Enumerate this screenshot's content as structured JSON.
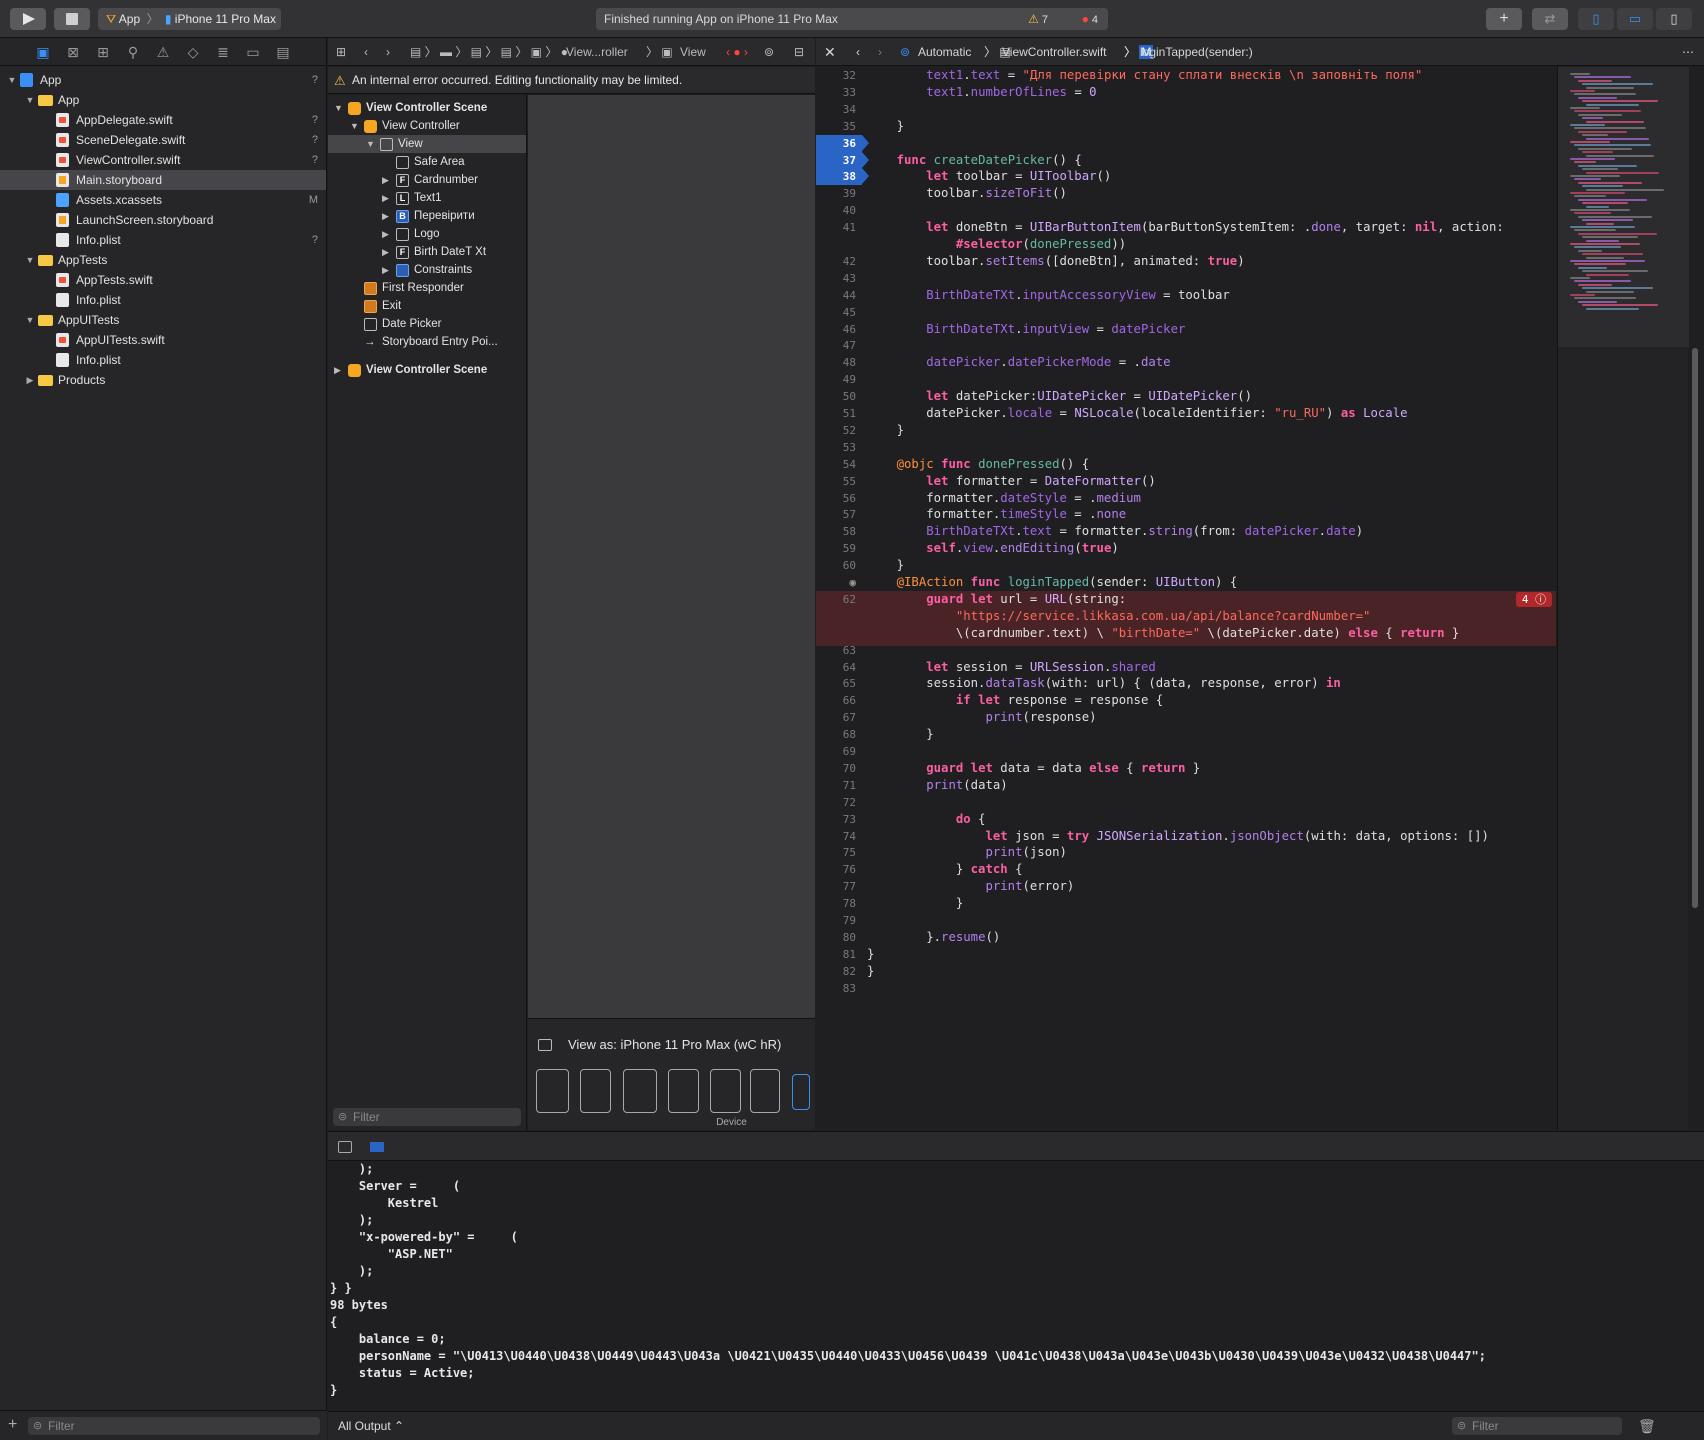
{
  "toolbar": {
    "scheme_app": "App",
    "scheme_device": "iPhone 11 Pro Max",
    "status_text": "Finished running App on iPhone 11 Pro Max",
    "warning_count": "7",
    "error_count": "4",
    "add_icon": "plus-icon"
  },
  "navigator": {
    "items": [
      {
        "label": "App",
        "badge": "?",
        "level": 0,
        "type": "proj",
        "disc": "▼"
      },
      {
        "label": "App",
        "badge": "",
        "level": 1,
        "type": "folder",
        "disc": "▼"
      },
      {
        "label": "AppDelegate.swift",
        "badge": "?",
        "level": 2,
        "type": "swift",
        "disc": ""
      },
      {
        "label": "SceneDelegate.swift",
        "badge": "?",
        "level": 2,
        "type": "swift",
        "disc": ""
      },
      {
        "label": "ViewController.swift",
        "badge": "?",
        "level": 2,
        "type": "swift",
        "disc": ""
      },
      {
        "label": "Main.storyboard",
        "badge": "",
        "level": 2,
        "type": "sb",
        "disc": "",
        "selected": true
      },
      {
        "label": "Assets.xcassets",
        "badge": "M",
        "level": 2,
        "type": "assets",
        "disc": ""
      },
      {
        "label": "LaunchScreen.storyboard",
        "badge": "",
        "level": 2,
        "type": "sb",
        "disc": ""
      },
      {
        "label": "Info.plist",
        "badge": "?",
        "level": 2,
        "type": "plist",
        "disc": ""
      },
      {
        "label": "AppTests",
        "badge": "",
        "level": 1,
        "type": "folder",
        "disc": "▼"
      },
      {
        "label": "AppTests.swift",
        "badge": "",
        "level": 2,
        "type": "swift",
        "disc": ""
      },
      {
        "label": "Info.plist",
        "badge": "",
        "level": 2,
        "type": "plist",
        "disc": ""
      },
      {
        "label": "AppUITests",
        "badge": "",
        "level": 1,
        "type": "folder",
        "disc": "▼"
      },
      {
        "label": "AppUITests.swift",
        "badge": "",
        "level": 2,
        "type": "swift",
        "disc": ""
      },
      {
        "label": "Info.plist",
        "badge": "",
        "level": 2,
        "type": "plist",
        "disc": ""
      },
      {
        "label": "Products",
        "badge": "",
        "level": 1,
        "type": "folder",
        "disc": "▶"
      }
    ],
    "filter_placeholder": "Filter"
  },
  "ib": {
    "jump_view_controller": "View...roller",
    "jump_view": "View",
    "warning_banner": "An internal error occurred. Editing functionality may be limited.",
    "outline": [
      {
        "label": "View Controller Scene",
        "level": 0,
        "disc": "▼",
        "icon": "yellow",
        "glyph": "",
        "bold": true
      },
      {
        "label": "View Controller",
        "level": 1,
        "disc": "▼",
        "icon": "yellow",
        "glyph": ""
      },
      {
        "label": "View",
        "level": 2,
        "disc": "▼",
        "icon": "plain",
        "glyph": "",
        "selected": true
      },
      {
        "label": "Safe Area",
        "level": 3,
        "disc": "",
        "icon": "plain",
        "glyph": ""
      },
      {
        "label": "Cardnumber",
        "level": 3,
        "disc": "▶",
        "icon": "plain",
        "glyph": "F"
      },
      {
        "label": "Text1",
        "level": 3,
        "disc": "▶",
        "icon": "plain",
        "glyph": "L"
      },
      {
        "label": "Перевірити",
        "level": 3,
        "disc": "▶",
        "icon": "blue",
        "glyph": "B"
      },
      {
        "label": "Logo",
        "level": 3,
        "disc": "▶",
        "icon": "plain",
        "glyph": ""
      },
      {
        "label": "Birth DateT Xt",
        "level": 3,
        "disc": "▶",
        "icon": "plain",
        "glyph": "F"
      },
      {
        "label": "Constraints",
        "level": 3,
        "disc": "▶",
        "icon": "blue",
        "glyph": ""
      },
      {
        "label": "First Responder",
        "level": 1,
        "disc": "",
        "icon": "orange",
        "glyph": ""
      },
      {
        "label": "Exit",
        "level": 1,
        "disc": "",
        "icon": "orange",
        "glyph": ""
      },
      {
        "label": "Date Picker",
        "level": 1,
        "disc": "",
        "icon": "plain",
        "glyph": ""
      },
      {
        "label": "Storyboard Entry Poi...",
        "level": 1,
        "disc": "",
        "icon": "arrow",
        "glyph": "→"
      },
      {
        "label": "View Controller Scene",
        "level": 0,
        "disc": "▶",
        "icon": "yellow",
        "glyph": "",
        "bold": true,
        "gap": true
      }
    ],
    "filter_placeholder": "Filter",
    "view_as": "View as: iPhone 11 Pro Max (wC hR)",
    "device_label": "Device"
  },
  "editor": {
    "jump_automatic": "Automatic",
    "jump_file": "ViewController.swift",
    "jump_method": "loginTapped(sender:)",
    "error_badge": "4",
    "lines": [
      {
        "n": "32",
        "html": "        <span class='pr'>text1</span>.<span class='pr'>text</span> = <span class='str'>\"Для перевірки стану сплати внесків \\n заповніть поля\"</span>"
      },
      {
        "n": "33",
        "html": "        <span class='pr'>text1</span>.<span class='pr'>numberOfLines</span> = <span class='ty'>0</span>"
      },
      {
        "n": "34",
        "html": ""
      },
      {
        "n": "35",
        "html": "    }"
      },
      {
        "n": "36",
        "html": "",
        "bp": true
      },
      {
        "n": "37",
        "html": "    <span class='kw'>func</span> <span class='fn'>createDatePicker</span>() {",
        "bp": true
      },
      {
        "n": "38",
        "html": "        <span class='kw'>let</span> toolbar = <span class='ty'>UIToolbar</span>()",
        "bp": true
      },
      {
        "n": "39",
        "html": "        toolbar.<span class='mth'>sizeToFit</span>()"
      },
      {
        "n": "40",
        "html": ""
      },
      {
        "n": "41",
        "html": "        <span class='kw'>let</span> doneBtn = <span class='ty'>UIBarButtonItem</span>(barButtonSystemItem: .<span class='mth'>done</span>, target: <span class='kw'>nil</span>, action:"
      },
      {
        "n": "",
        "html": "            <span class='kw'>#selector</span>(<span class='fn'>donePressed</span>))"
      },
      {
        "n": "42",
        "html": "        toolbar.<span class='mth'>setItems</span>([doneBtn], animated: <span class='kw'>true</span>)"
      },
      {
        "n": "43",
        "html": ""
      },
      {
        "n": "44",
        "html": "        <span class='pr'>BirthDateTXt</span>.<span class='pr'>inputAccessoryView</span> = toolbar"
      },
      {
        "n": "45",
        "html": ""
      },
      {
        "n": "46",
        "html": "        <span class='pr'>BirthDateTXt</span>.<span class='pr'>inputView</span> = <span class='pr'>datePicker</span>"
      },
      {
        "n": "47",
        "html": ""
      },
      {
        "n": "48",
        "html": "        <span class='pr'>datePicker</span>.<span class='pr'>datePickerMode</span> = .<span class='mth'>date</span>"
      },
      {
        "n": "49",
        "html": ""
      },
      {
        "n": "50",
        "html": "        <span class='kw'>let</span> datePicker:<span class='ty'>UIDatePicker</span> = <span class='ty'>UIDatePicker</span>()"
      },
      {
        "n": "51",
        "html": "        datePicker.<span class='pr'>locale</span> = <span class='ty'>NSLocale</span>(localeIdentifier: <span class='str'>\"ru_RU\"</span>) <span class='kw'>as</span> <span class='ty'>Locale</span>"
      },
      {
        "n": "52",
        "html": "    }"
      },
      {
        "n": "53",
        "html": ""
      },
      {
        "n": "54",
        "html": "    <span class='at'>@objc</span> <span class='kw'>func</span> <span class='fn'>donePressed</span>() {"
      },
      {
        "n": "55",
        "html": "        <span class='kw'>let</span> formatter = <span class='ty'>DateFormatter</span>()"
      },
      {
        "n": "56",
        "html": "        formatter.<span class='pr'>dateStyle</span> = .<span class='mth'>medium</span>"
      },
      {
        "n": "57",
        "html": "        formatter.<span class='pr'>timeStyle</span> = .<span class='mth'>none</span>"
      },
      {
        "n": "58",
        "html": "        <span class='pr'>BirthDateTXt</span>.<span class='pr'>text</span> = formatter.<span class='mth'>string</span>(from: <span class='pr'>datePicker</span>.<span class='pr'>date</span>)"
      },
      {
        "n": "59",
        "html": "        <span class='kw'>self</span>.<span class='pr'>view</span>.<span class='mth'>endEditing</span>(<span class='kw'>true</span>)"
      },
      {
        "n": "60",
        "html": "    }"
      },
      {
        "n": "",
        "html": "    <span class='at'>@IBAction</span> <span class='kw'>func</span> <span class='fn'>loginTapped</span>(sender: <span class='ty'>UIButton</span>) {",
        "outlet": true
      },
      {
        "n": "62",
        "html": "        <span class='kw'>guard</span> <span class='kw'>let</span> url = <span class='ty'>URL</span>(string:",
        "err": true
      },
      {
        "n": "",
        "html": "            <span class='str'>\"https://service.likkasa.com.ua/api/balance?cardNumber=\"</span>",
        "err": true
      },
      {
        "n": "",
        "html": "            \\(cardnumber.text) \\ <span class='str'>\"birthDate=\"</span> \\(datePicker.date) <span class='kw'>else</span> { <span class='kw'>return</span> }",
        "err": true
      },
      {
        "n": "63",
        "html": ""
      },
      {
        "n": "64",
        "html": "        <span class='kw'>let</span> session = <span class='ty'>URLSession</span>.<span class='pr'>shared</span>"
      },
      {
        "n": "65",
        "html": "        session.<span class='mth'>dataTask</span>(with: url) { (data, response, error) <span class='kw'>in</span>"
      },
      {
        "n": "66",
        "html": "            <span class='kw'>if</span> <span class='kw'>let</span> response = response {"
      },
      {
        "n": "67",
        "html": "                <span class='mth'>print</span>(response)"
      },
      {
        "n": "68",
        "html": "        }"
      },
      {
        "n": "69",
        "html": ""
      },
      {
        "n": "70",
        "html": "        <span class='kw'>guard</span> <span class='kw'>let</span> data = data <span class='kw'>else</span> { <span class='kw'>return</span> }"
      },
      {
        "n": "71",
        "html": "        <span class='mth'>print</span>(data)"
      },
      {
        "n": "72",
        "html": ""
      },
      {
        "n": "73",
        "html": "            <span class='kw'>do</span> {"
      },
      {
        "n": "74",
        "html": "                <span class='kw'>let</span> json = <span class='kw'>try</span> <span class='ty'>JSONSerialization</span>.<span class='mth'>jsonObject</span>(with: data, options: [])"
      },
      {
        "n": "75",
        "html": "                <span class='mth'>print</span>(json)"
      },
      {
        "n": "76",
        "html": "            } <span class='kw'>catch</span> {"
      },
      {
        "n": "77",
        "html": "                <span class='mth'>print</span>(error)"
      },
      {
        "n": "78",
        "html": "            }"
      },
      {
        "n": "79",
        "html": ""
      },
      {
        "n": "80",
        "html": "        }.<span class='mth'>resume</span>()"
      },
      {
        "n": "81",
        "html": "}"
      },
      {
        "n": "82",
        "html": "}"
      },
      {
        "n": "83",
        "html": ""
      }
    ]
  },
  "console": {
    "lines": [
      "    );",
      "    Server =     (",
      "        Kestrel",
      "    );",
      "    \"x-powered-by\" =     (",
      "        \"ASP.NET\"",
      "    );",
      "} }",
      "98 bytes",
      "{",
      "    balance = 0;",
      "    personName = \"\\U0413\\U0440\\U0438\\U0449\\U0443\\U043a \\U0421\\U0435\\U0440\\U0433\\U0456\\U0439 \\U041c\\U0438\\U043a\\U043e\\U043b\\U0430\\U0439\\U043e\\U0432\\U0438\\U0447\";",
      "    status = Active;",
      "}"
    ],
    "output_select": "All Output ⌃",
    "filter_placeholder": "Filter"
  }
}
